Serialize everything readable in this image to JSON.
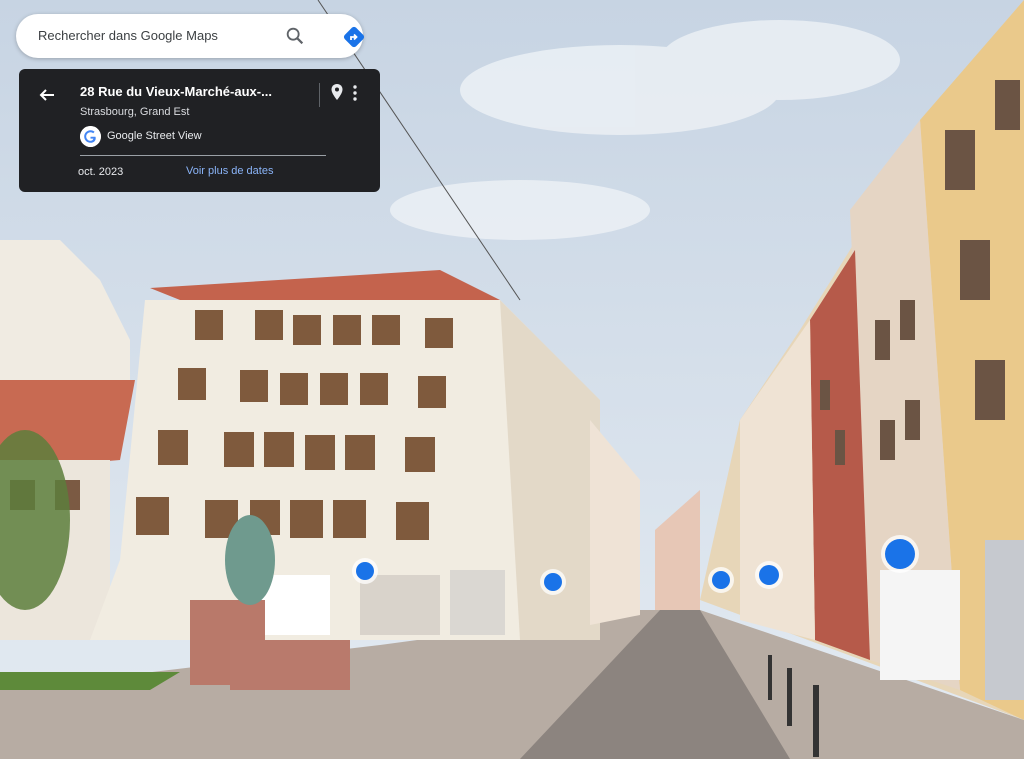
{
  "search": {
    "placeholder": "Rechercher dans Google Maps",
    "search_icon": "search-icon",
    "directions_icon": "directions-icon"
  },
  "location": {
    "title": "28 Rue du Vieux-Marché-aux-...",
    "subtitle": "Strasbourg, Grand Est",
    "source": "Google Street View",
    "date": "oct. 2023",
    "more_dates": "Voir plus de dates"
  },
  "colors": {
    "panel_bg": "#202124",
    "link": "#8ab4f8",
    "poi": "#1a73e8",
    "sky": "#cfdbe8"
  },
  "poi_markers": [
    {
      "type": "shopping-bag"
    },
    {
      "type": "shopping-bag"
    },
    {
      "type": "place-pin"
    },
    {
      "type": "shopping-bag"
    },
    {
      "type": "shopping-bag"
    }
  ]
}
